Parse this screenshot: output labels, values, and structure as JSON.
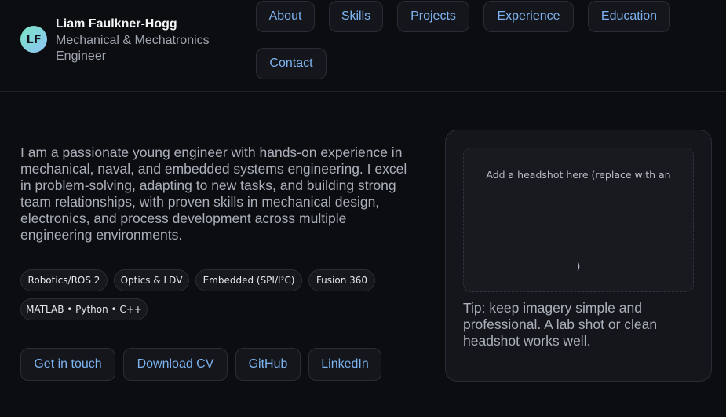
{
  "header": {
    "avatar_initials": "LF",
    "name": "Liam Faulkner-Hogg",
    "role": "Mechanical & Mechatronics Engineer"
  },
  "nav": {
    "about": "About",
    "skills": "Skills",
    "projects": "Projects",
    "experience": "Experience",
    "education": "Education",
    "contact": "Contact"
  },
  "hero": {
    "bio": "I am a passionate young engineer with hands-on experience in mechanical, naval, and embedded systems engineering. I excel in problem-solving, adapting to new tasks, and building strong team relationships, with proven skills in mechanical design, electronics, and process development across multiple engineering environments.",
    "chips": [
      "Robotics/ROS 2",
      "Optics & LDV",
      "Embedded (SPI/I²C)",
      "Fusion 360",
      "MATLAB • Python • C++"
    ],
    "actions": {
      "contact": "Get in touch",
      "cv": "Download CV",
      "github": "GitHub",
      "linkedin": "LinkedIn"
    }
  },
  "photo_card": {
    "placeholder_top": "Add a headshot here (replace with an",
    "placeholder_bottom": ")",
    "tip": "Tip: keep imagery simple and professional. A lab shot or clean headshot works well."
  },
  "colors": {
    "background": "#0c0d11",
    "link_accent": "#7db3f0",
    "avatar_gradient_start": "#7ae3c4",
    "avatar_gradient_end": "#8ec5f5"
  }
}
